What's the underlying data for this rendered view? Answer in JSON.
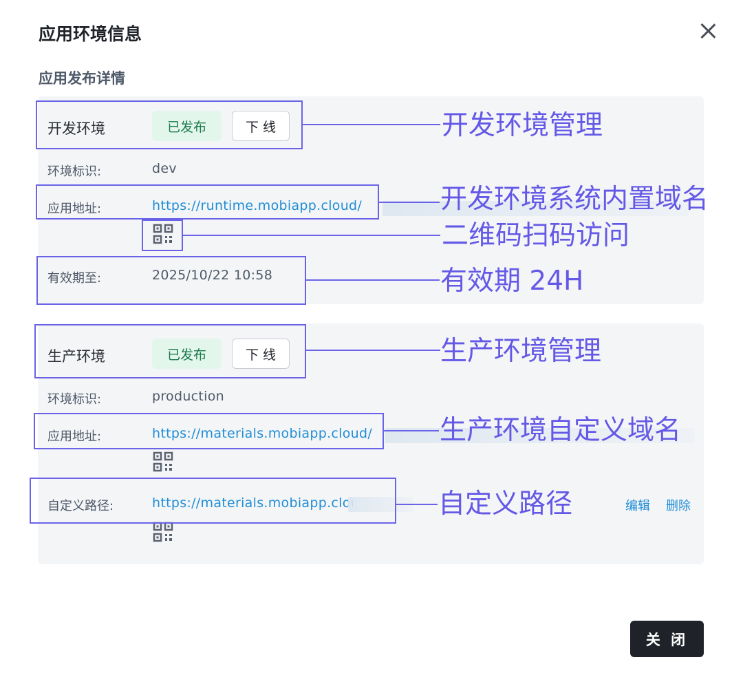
{
  "dialog": {
    "title": "应用环境信息",
    "subtitle": "应用发布详情",
    "close_label": "关 闭"
  },
  "dev": {
    "name": "开发环境",
    "status": "已发布",
    "offline_label": "下 线",
    "id_label": "环境标识:",
    "id_value": "dev",
    "url_label": "应用地址:",
    "url_value": "https://runtime.mobiapp.cloud/",
    "expiry_label": "有效期至:",
    "expiry_value": "2025/10/22 10:58"
  },
  "prod": {
    "name": "生产环境",
    "status": "已发布",
    "offline_label": "下 线",
    "id_label": "环境标识:",
    "id_value": "production",
    "url_label": "应用地址:",
    "url_value": "https://materials.mobiapp.cloud/",
    "path_label": "自定义路径:",
    "path_value": "https://materials.mobiapp.cloud",
    "edit_label": "编辑",
    "delete_label": "删除"
  },
  "annotations": {
    "dev_manage": "开发环境管理",
    "dev_domain": "开发环境系统内置域名",
    "qr_access": "二维码扫码访问",
    "validity": "有效期 24H",
    "prod_manage": "生产环境管理",
    "prod_domain": "生产环境自定义域名",
    "custom_path": "自定义路径"
  },
  "colors": {
    "accent": "#1f8dd6",
    "annotation": "#6459e6",
    "badge_bg": "#e2f6ec",
    "badge_text": "#1e7a4c",
    "primary_btn": "#1f2329"
  },
  "icons": {
    "close": "close-icon",
    "qr": "qr-code-icon"
  }
}
